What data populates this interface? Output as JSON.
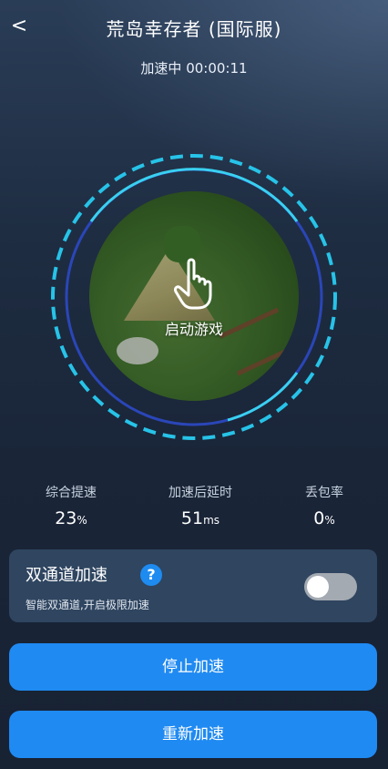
{
  "header": {
    "back_label": "<",
    "title": "荒岛幸存者 (国际服)",
    "timer": "加速中 00:00:11"
  },
  "center": {
    "start_label": "启动游戏",
    "hand_icon": "hand-pointer-icon",
    "ring_color": "#27c3e8",
    "inner_ring_color": "#2a46b8"
  },
  "stats": [
    {
      "label": "综合提速",
      "value": "23",
      "unit": "%"
    },
    {
      "label": "加速后延时",
      "value": "51",
      "unit": "ms"
    },
    {
      "label": "丢包率",
      "value": "0",
      "unit": "%"
    }
  ],
  "dual_channel": {
    "title": "双通道加速",
    "help_label": "?",
    "subtitle": "智能双通道,开启极限加速",
    "enabled": false
  },
  "buttons": {
    "stop_label": "停止加速",
    "restart_label": "重新加速",
    "color": "#1f8af2"
  }
}
